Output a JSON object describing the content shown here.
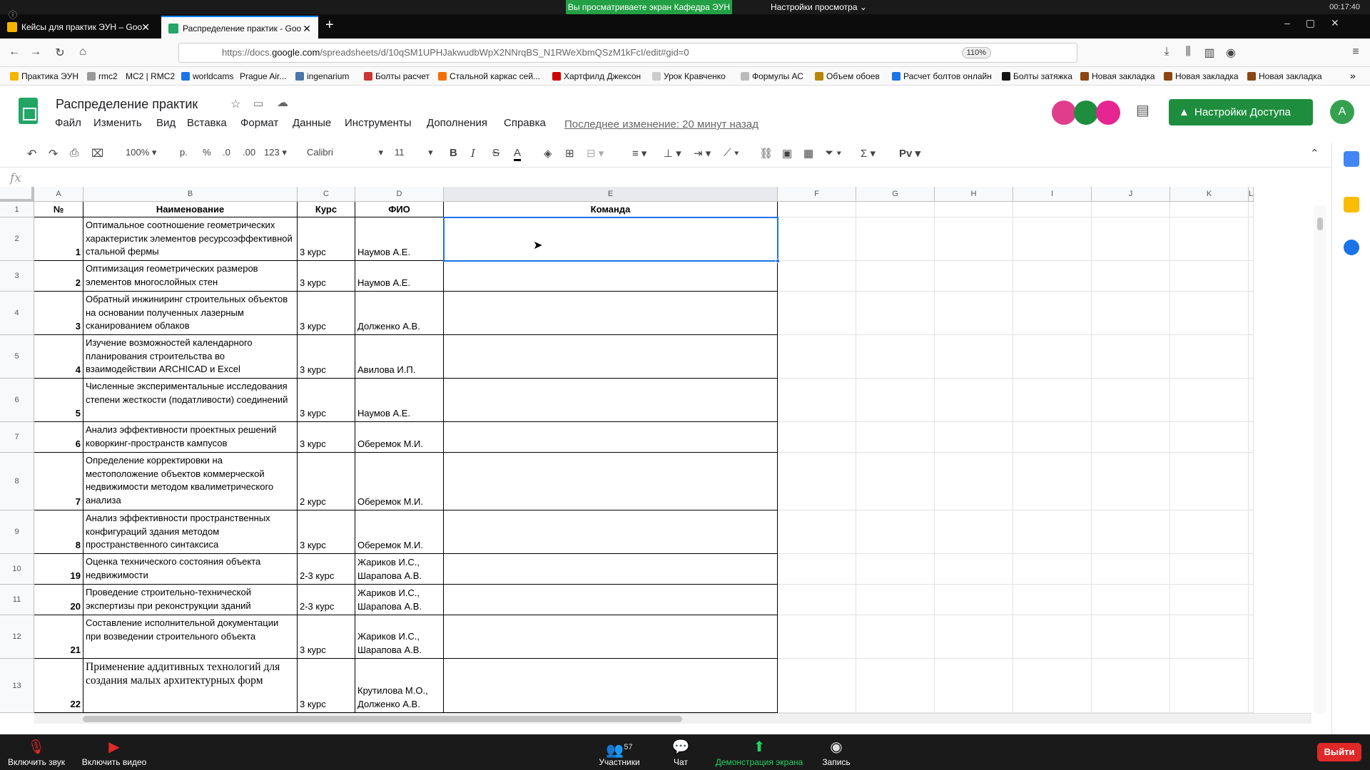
{
  "zoom": {
    "banner": "Вы просматриваете экран Кафедра ЭУН",
    "view_options": "Настройки просмотра ⌄",
    "timer": "00:17:40",
    "bottom": {
      "mute": "Включить звук",
      "video": "Включить видео",
      "participants": "Участники",
      "participants_count": "57",
      "chat": "Чат",
      "share": "Демонстрация экрана",
      "record": "Запись",
      "leave": "Выйти"
    }
  },
  "browser": {
    "tabs": [
      {
        "label": "Кейсы для практик ЭУН – Goo",
        "active": false
      },
      {
        "label": "Распределение практик - Goo",
        "active": true
      }
    ],
    "url_prefix": "https://docs.",
    "url_host": "google.com",
    "url_path": "/spreadsheets/d/10qSM1UPHJakwudbWpX2NNrqBS_N1RWeXbmQSzM1kFcI/edit#gid=0",
    "zoom": "110%",
    "bookmarks": [
      "Практика ЭУН",
      "rmc2",
      "MC2 | RMC2",
      "worldcams",
      "Prague Air...",
      "ingenarium",
      "Болты расчет",
      "Стальной каркас сей...",
      "Хартфилд Джексон",
      "Урок Кравченко",
      "Формулы АС",
      "Объем обоев",
      "Расчет болтов онлайн",
      "Болты затяжка",
      "Новая закладка",
      "Новая закладка",
      "Новая закладка"
    ]
  },
  "sheets": {
    "title": "Распределение практик",
    "menus": [
      "Файл",
      "Изменить",
      "Вид",
      "Вставка",
      "Формат",
      "Данные",
      "Инструменты",
      "Дополнения",
      "Справка"
    ],
    "last_edit": "Последнее изменение: 20 минут назад",
    "share_button": "Настройки Доступа",
    "account_initial": "A",
    "toolbar": {
      "zoom": "100%",
      "currency": "р.",
      "percent": "%",
      "dec_less": ".0",
      "dec_more": ".00",
      "format": "123",
      "font": "Calibri",
      "size": "11"
    },
    "fx": "fx",
    "columns": [
      "A",
      "B",
      "C",
      "D",
      "E",
      "F",
      "G",
      "H",
      "I",
      "J",
      "K",
      "L"
    ],
    "header_row": {
      "num": "№",
      "name": "Наименование",
      "course": "Курс",
      "fio": "ФИО",
      "team": "Команда"
    },
    "rows": [
      {
        "row": "2",
        "num": "1",
        "name": "Оптимальное соотношение геометрических характеристик элементов ресурсоэффективной стальной фермы",
        "course": "3 курс",
        "fio": "Наумов А.Е."
      },
      {
        "row": "3",
        "num": "2",
        "name": "Оптимизация геометрических размеров элементов многослойных стен",
        "course": "3 курс",
        "fio": "Наумов А.Е."
      },
      {
        "row": "4",
        "num": "3",
        "name": "Обратный инжиниринг строительных объектов на основании полученных лазерным сканированием облаков",
        "course": "3 курс",
        "fio": "Долженко А.В."
      },
      {
        "row": "5",
        "num": "4",
        "name": "Изучение возможностей календарного планирования строительства во взаимодействии ARCHICAD и Excel",
        "course": "3 курс",
        "fio": "Авилова И.П."
      },
      {
        "row": "6",
        "num": "5",
        "name": "Численные экспериментальные исследования степени жесткости (податливости) соединений",
        "course": "3 курс",
        "fio": "Наумов А.Е."
      },
      {
        "row": "7",
        "num": "6",
        "name": "Анализ эффективности проектных решений коворкинг-пространств кампусов",
        "course": "3 курс",
        "fio": "Оберемок М.И."
      },
      {
        "row": "8",
        "num": "7",
        "name": "Определение корректировки на местоположение объектов коммерческой недвижимости методом квалиметрического анализа",
        "course": "2 курс",
        "fio": "Оберемок М.И."
      },
      {
        "row": "9",
        "num": "8",
        "name": "Анализ эффективности пространственных конфигураций здания методом пространственного синтаксиса",
        "course": "3 курс",
        "fio": "Оберемок М.И."
      },
      {
        "row": "10",
        "num": "19",
        "name": "Оценка технического состояния объекта недвижимости",
        "course": "2-3 курс",
        "fio": "Жариков И.С., Шарапова А.В."
      },
      {
        "row": "11",
        "num": "20",
        "name": "Проведение строительно-технической экспертизы при реконструкции зданий",
        "course": "2-3 курс",
        "fio": "Жариков И.С., Шарапова А.В."
      },
      {
        "row": "12",
        "num": "21",
        "name": "Составление исполнительной документации при возведении строительного объекта",
        "course": "3 курс",
        "fio": "Жариков И.С., Шарапова А.В."
      },
      {
        "row": "13",
        "num": "22",
        "name": "Применение аддитивных технологий для создания малых архитектурных форм",
        "course": "3 курс",
        "fio": "Крутилова М.О., Долженко А.В."
      }
    ]
  }
}
